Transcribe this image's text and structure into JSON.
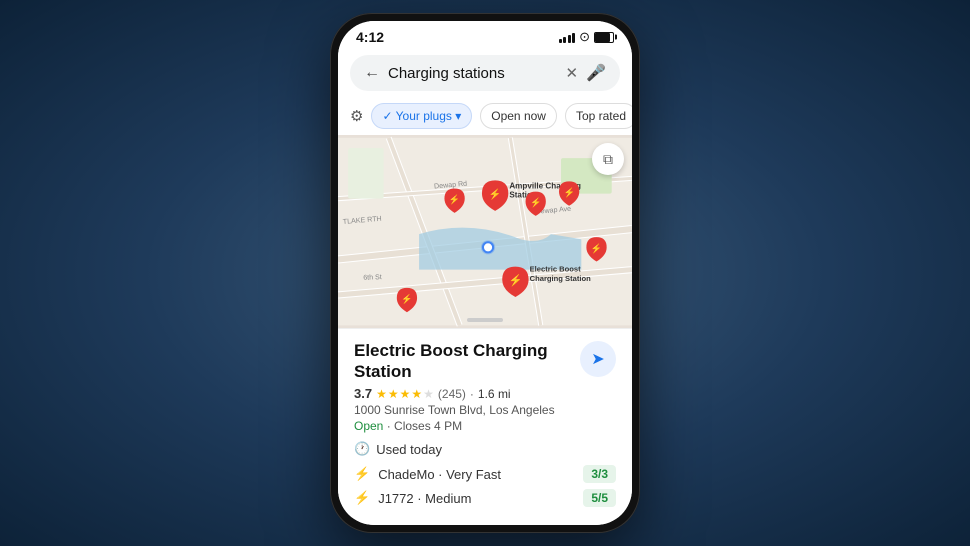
{
  "statusBar": {
    "time": "4:12",
    "ariaLabel": "Status bar"
  },
  "searchBar": {
    "backArrow": "←",
    "query": "Charging stations",
    "clearIcon": "✕",
    "micIcon": "🎤"
  },
  "filters": {
    "filterIcon": "⚙",
    "chips": [
      {
        "label": "✓ Your plugs ▾",
        "active": true
      },
      {
        "label": "Open now",
        "active": false
      },
      {
        "label": "Top rated",
        "active": false
      }
    ]
  },
  "map": {
    "layerIcon": "⧉",
    "ariaLabel": "Map view"
  },
  "place": {
    "name": "Electric Boost Charging Station",
    "rating": "3.7",
    "reviewCount": "(245)",
    "distance": "1.6 mi",
    "address": "1000 Sunrise Town Blvd, Los Angeles",
    "openStatus": "Open",
    "closesTime": "Closes 4 PM",
    "usedToday": "Used today",
    "chargers": [
      {
        "name": "ChadeMo · Very Fast",
        "availability": "3/3"
      },
      {
        "name": "J1772 · Medium",
        "availability": "5/5"
      }
    ],
    "directionsIcon": "➤"
  }
}
